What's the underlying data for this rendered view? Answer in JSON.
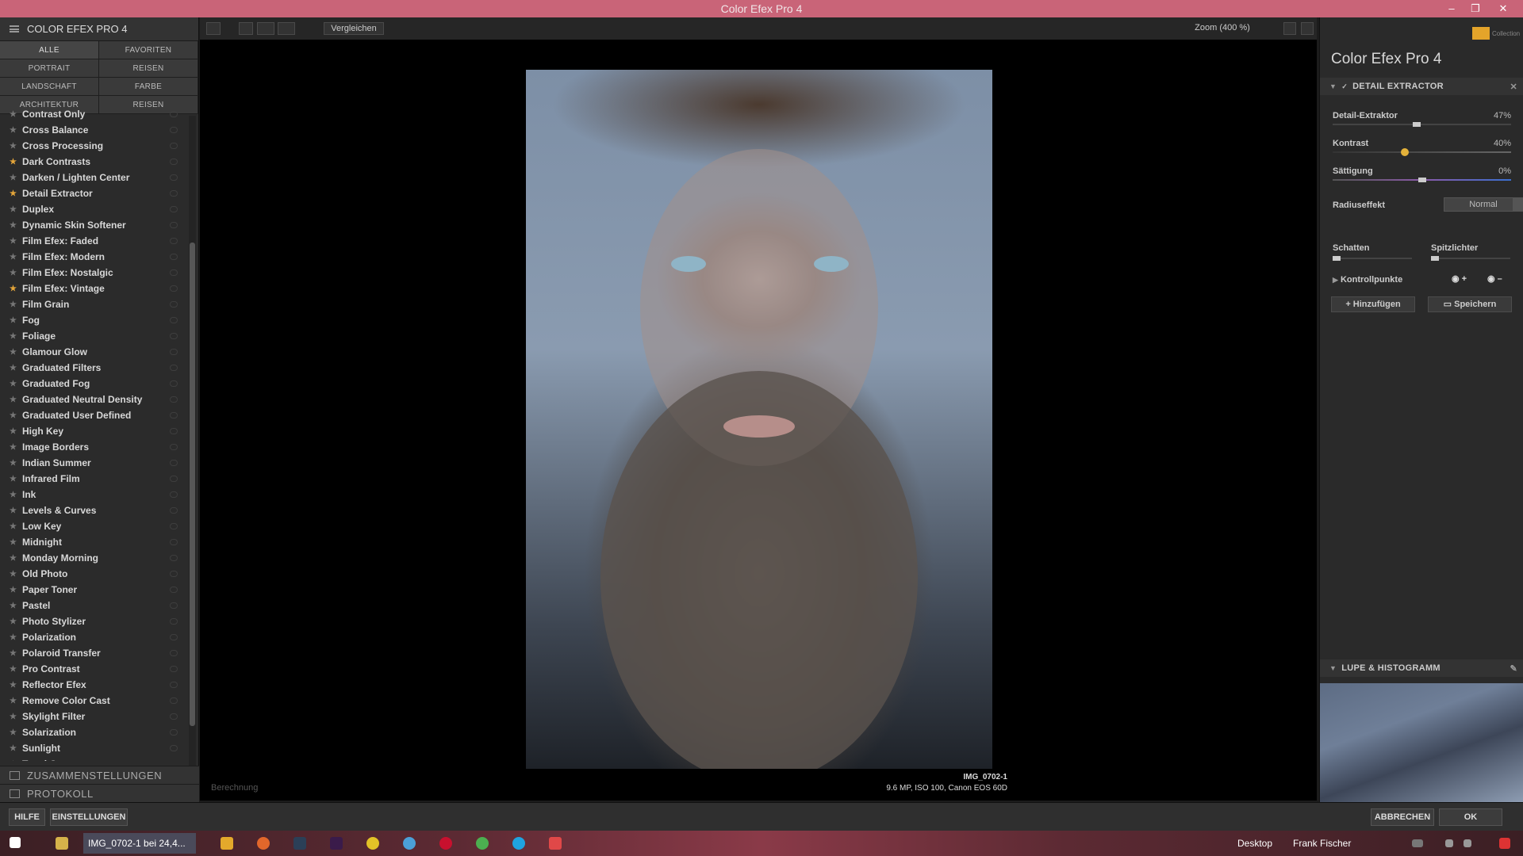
{
  "window": {
    "title": "Color Efex Pro 4",
    "controls": [
      "–",
      "❐",
      "✕"
    ]
  },
  "left": {
    "header": "COLOR EFEX PRO 4",
    "categories": [
      "ALLE",
      "FAVORITEN",
      "PORTRAIT",
      "REISEN",
      "LANDSCHAFT",
      "FARBE",
      "ARCHITEKTUR",
      "REISEN"
    ],
    "filters": [
      {
        "name": "Contrast Only",
        "fav": false
      },
      {
        "name": "Cross Balance",
        "fav": false
      },
      {
        "name": "Cross Processing",
        "fav": false
      },
      {
        "name": "Dark Contrasts",
        "fav": true
      },
      {
        "name": "Darken / Lighten Center",
        "fav": false
      },
      {
        "name": "Detail Extractor",
        "fav": true
      },
      {
        "name": "Duplex",
        "fav": false
      },
      {
        "name": "Dynamic Skin Softener",
        "fav": false
      },
      {
        "name": "Film Efex: Faded",
        "fav": false
      },
      {
        "name": "Film Efex: Modern",
        "fav": false
      },
      {
        "name": "Film Efex: Nostalgic",
        "fav": false
      },
      {
        "name": "Film Efex: Vintage",
        "fav": true
      },
      {
        "name": "Film Grain",
        "fav": false
      },
      {
        "name": "Fog",
        "fav": false
      },
      {
        "name": "Foliage",
        "fav": false
      },
      {
        "name": "Glamour Glow",
        "fav": false
      },
      {
        "name": "Graduated Filters",
        "fav": false
      },
      {
        "name": "Graduated Fog",
        "fav": false
      },
      {
        "name": "Graduated Neutral Density",
        "fav": false
      },
      {
        "name": "Graduated User Defined",
        "fav": false
      },
      {
        "name": "High Key",
        "fav": false
      },
      {
        "name": "Image Borders",
        "fav": false
      },
      {
        "name": "Indian Summer",
        "fav": false
      },
      {
        "name": "Infrared Film",
        "fav": false
      },
      {
        "name": "Ink",
        "fav": false
      },
      {
        "name": "Levels & Curves",
        "fav": false
      },
      {
        "name": "Low Key",
        "fav": false
      },
      {
        "name": "Midnight",
        "fav": false
      },
      {
        "name": "Monday Morning",
        "fav": false
      },
      {
        "name": "Old Photo",
        "fav": false
      },
      {
        "name": "Paper Toner",
        "fav": false
      },
      {
        "name": "Pastel",
        "fav": false
      },
      {
        "name": "Photo Stylizer",
        "fav": false
      },
      {
        "name": "Polarization",
        "fav": false
      },
      {
        "name": "Polaroid Transfer",
        "fav": false
      },
      {
        "name": "Pro Contrast",
        "fav": false
      },
      {
        "name": "Reflector Efex",
        "fav": false
      },
      {
        "name": "Remove Color Cast",
        "fav": false
      },
      {
        "name": "Skylight Filter",
        "fav": false
      },
      {
        "name": "Solarization",
        "fav": false
      },
      {
        "name": "Sunlight",
        "fav": false
      },
      {
        "name": "Tonal Contrast",
        "fav": false
      }
    ],
    "sections": [
      "ZUSAMMENSTELLUNGEN",
      "PROTOKOLL"
    ]
  },
  "toolbar": {
    "compare": "Vergleichen",
    "zoom": "Zoom (400 %)"
  },
  "image": {
    "name": "IMG_0702-1",
    "info": "9.6 MP, ISO 100, Canon EOS 60D",
    "status": "Berechnung"
  },
  "right": {
    "brand_small": "Collection",
    "title": "Color Efex Pro 4",
    "filter_header": "DETAIL EXTRACTOR",
    "sliders": [
      {
        "label": "Detail-Extraktor",
        "value": "47%",
        "level": 0.47
      },
      {
        "label": "Kontrast",
        "value": "40%",
        "level": 0.4
      },
      {
        "label": "Sättigung",
        "value": "0%",
        "level": 0.5
      }
    ],
    "radius_label": "Radiuseffekt",
    "radius_value": "Normal",
    "shadows": "Schatten",
    "highlights": "Spitzlichter",
    "control_points": "Kontrollpunkte",
    "add": "Hinzufügen",
    "save": "Speichern",
    "loupe": "LUPE & HISTOGRAMM"
  },
  "bottom": {
    "help": "HILFE",
    "settings": "EINSTELLUNGEN",
    "cancel": "ABBRECHEN",
    "ok": "OK"
  },
  "taskbar": {
    "task": "IMG_0702-1 bei 24,4...",
    "desktop": "Desktop",
    "user": "Frank Fischer"
  }
}
